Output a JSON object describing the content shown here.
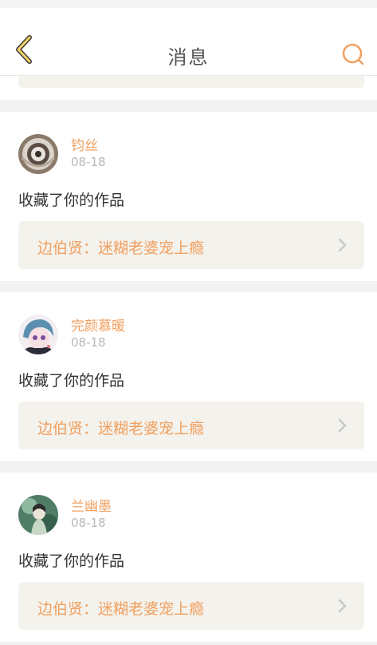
{
  "header": {
    "title": "消息",
    "back_icon": "chevron-left-icon",
    "search_icon": "search-icon",
    "accent_color": "#f0a060"
  },
  "messages": [
    {
      "username": "钧丝",
      "date": "08-18",
      "action": "收藏了你的作品",
      "work_title": "边伯贤：迷糊老婆宠上瘾"
    },
    {
      "username": "完颜慕暖",
      "date": "08-18",
      "action": "收藏了你的作品",
      "work_title": "边伯贤：迷糊老婆宠上瘾"
    },
    {
      "username": "兰幽墨",
      "date": "08-18",
      "action": "收藏了你的作品",
      "work_title": "边伯贤：迷糊老婆宠上瘾"
    }
  ]
}
